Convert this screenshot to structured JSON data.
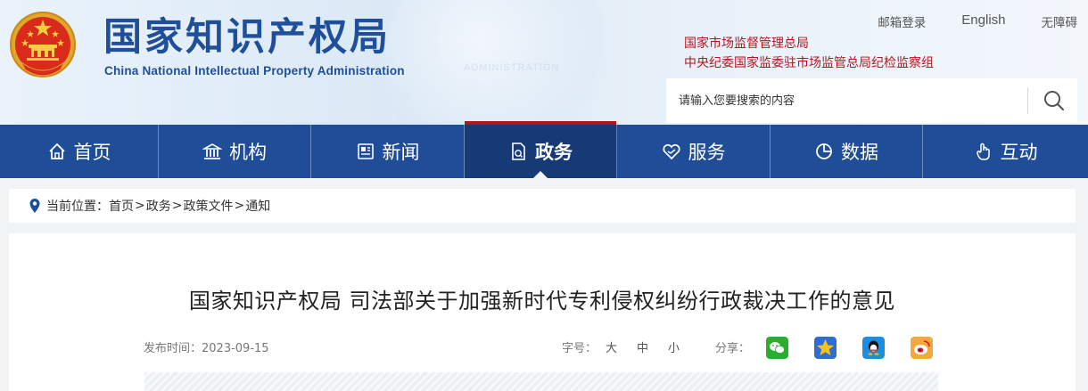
{
  "header": {
    "site_title": "国家知识产权局",
    "site_title_en": "China National Intellectual Property Administration",
    "top_links": {
      "mail_login": "邮箱登录",
      "english": "English",
      "accessibility": "无障碍"
    },
    "org_line_1": "国家市场监督管理总局",
    "org_line_2": "中央纪委国家监委驻市场监管总局纪检监察组",
    "search": {
      "placeholder": "请输入您要搜索的内容"
    }
  },
  "nav": {
    "items": [
      {
        "label": "首页",
        "icon": "home-icon"
      },
      {
        "label": "机构",
        "icon": "institution-icon"
      },
      {
        "label": "新闻",
        "icon": "newspaper-icon"
      },
      {
        "label": "政务",
        "icon": "document-icon",
        "active": true
      },
      {
        "label": "服务",
        "icon": "handshake-heart-icon"
      },
      {
        "label": "数据",
        "icon": "pie-chart-icon"
      },
      {
        "label": "互动",
        "icon": "hand-pointer-icon"
      }
    ]
  },
  "breadcrumb": {
    "prefix": "当前位置：",
    "items": [
      "首页",
      "政务",
      "政策文件",
      "通知"
    ]
  },
  "article": {
    "title": "国家知识产权局 司法部关于加强新时代专利侵权纠纷行政裁决工作的意见",
    "publish_label": "发布时间：",
    "publish_date": "2023-09-15",
    "font_size_label": "字号：",
    "font_sizes": [
      "大",
      "中",
      "小"
    ],
    "share_label": "分享："
  },
  "colors": {
    "brand_blue": "#1f4d97",
    "nav_active": "#163a75",
    "accent_red": "#b3171d"
  }
}
